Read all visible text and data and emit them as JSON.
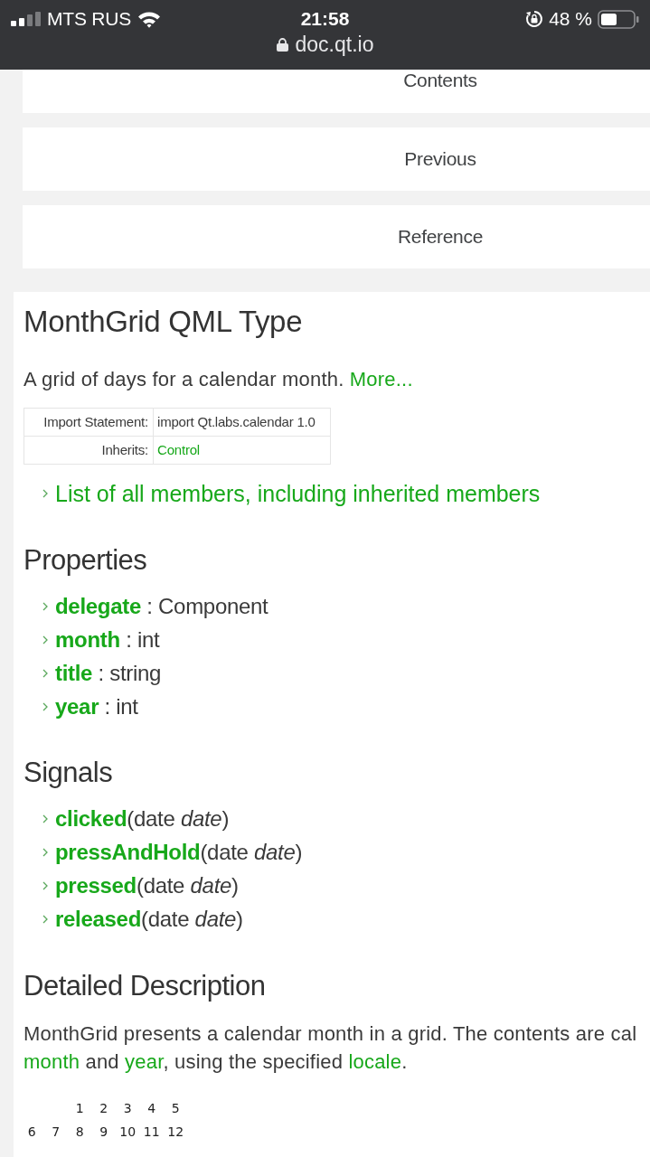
{
  "status_bar": {
    "carrier": "MTS RUS",
    "time": "21:58",
    "battery": "48 %"
  },
  "address_bar": {
    "url": "doc.qt.io"
  },
  "nav_links": [
    {
      "label": "Contents"
    },
    {
      "label": "Previous"
    },
    {
      "label": "Reference"
    }
  ],
  "page": {
    "title": "MonthGrid QML Type",
    "brief": {
      "text": "A grid of days for a calendar month.",
      "link": "More..."
    },
    "info_table": [
      {
        "label": "Import Statement:",
        "value": "import Qt.labs.calendar 1.0",
        "link": false
      },
      {
        "label": "Inherits:",
        "value": "Control",
        "link": true
      }
    ],
    "members_link": "List of all members, including inherited members",
    "sections": [
      {
        "heading": "Properties",
        "kind": "property",
        "items": [
          {
            "name": "delegate",
            "signature": " : Component"
          },
          {
            "name": "month",
            "signature": " : int"
          },
          {
            "name": "title",
            "signature": " : string"
          },
          {
            "name": "year",
            "signature": " : int"
          }
        ]
      },
      {
        "heading": "Signals",
        "kind": "signal",
        "items": [
          {
            "name": "clicked",
            "signature": "(date *date*)"
          },
          {
            "name": "pressAndHold",
            "signature": "(date *date*)"
          },
          {
            "name": "pressed",
            "signature": "(date *date*)"
          },
          {
            "name": "released",
            "signature": "(date *date*)"
          }
        ]
      }
    ],
    "description": {
      "heading": "Detailed Description",
      "lines": [
        [
          {
            "text": "MonthGrid presents a calendar month in a grid. The contents are cal",
            "link": false
          }
        ],
        [
          {
            "text": "month",
            "link": true
          },
          {
            "text": " and ",
            "link": false
          },
          {
            "text": "year",
            "link": true
          },
          {
            "text": ", using the specified ",
            "link": false
          },
          {
            "text": "locale",
            "link": true
          },
          {
            "text": ".",
            "link": false
          }
        ]
      ]
    },
    "calendar": {
      "weeks": [
        [
          "1",
          "2",
          "3",
          "4",
          "5"
        ],
        [
          "6",
          "7",
          "8",
          "9",
          "10",
          "11",
          "12"
        ]
      ]
    }
  }
}
